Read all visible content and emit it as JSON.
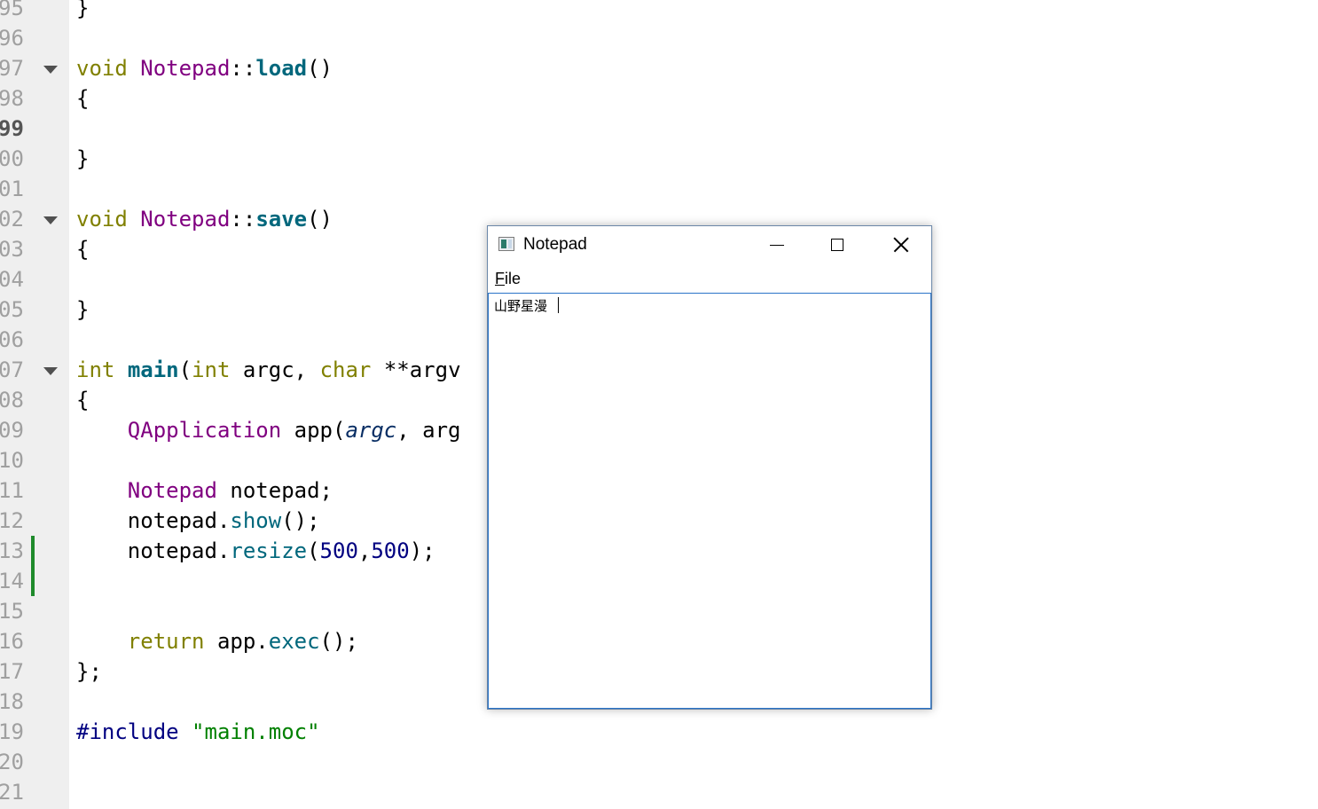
{
  "editor": {
    "lines": [
      {
        "num": "95",
        "segments": [
          {
            "t": "}",
            "c": ""
          }
        ]
      },
      {
        "num": "96",
        "segments": []
      },
      {
        "num": "97",
        "fold": true,
        "segments": [
          {
            "t": "void",
            "c": "kw"
          },
          {
            "t": " ",
            "c": ""
          },
          {
            "t": "Notepad",
            "c": "ty"
          },
          {
            "t": "::",
            "c": ""
          },
          {
            "t": "load",
            "c": "fn"
          },
          {
            "t": "()",
            "c": ""
          }
        ]
      },
      {
        "num": "98",
        "segments": [
          {
            "t": "{",
            "c": ""
          }
        ]
      },
      {
        "num": "99",
        "current": true,
        "segments": []
      },
      {
        "num": "00",
        "segments": [
          {
            "t": "}",
            "c": ""
          }
        ]
      },
      {
        "num": "01",
        "segments": []
      },
      {
        "num": "02",
        "fold": true,
        "segments": [
          {
            "t": "void",
            "c": "kw"
          },
          {
            "t": " ",
            "c": ""
          },
          {
            "t": "Notepad",
            "c": "ty"
          },
          {
            "t": "::",
            "c": ""
          },
          {
            "t": "save",
            "c": "fn"
          },
          {
            "t": "()",
            "c": ""
          }
        ]
      },
      {
        "num": "03",
        "segments": [
          {
            "t": "{",
            "c": ""
          }
        ]
      },
      {
        "num": "04",
        "segments": []
      },
      {
        "num": "05",
        "segments": [
          {
            "t": "}",
            "c": ""
          }
        ]
      },
      {
        "num": "06",
        "segments": []
      },
      {
        "num": "07",
        "fold": true,
        "segments": [
          {
            "t": "int",
            "c": "kw"
          },
          {
            "t": " ",
            "c": ""
          },
          {
            "t": "main",
            "c": "fn"
          },
          {
            "t": "(",
            "c": ""
          },
          {
            "t": "int",
            "c": "kw"
          },
          {
            "t": " argc, ",
            "c": ""
          },
          {
            "t": "char",
            "c": "kw"
          },
          {
            "t": " **argv",
            "c": ""
          }
        ]
      },
      {
        "num": "08",
        "segments": [
          {
            "t": "{",
            "c": ""
          }
        ]
      },
      {
        "num": "09",
        "segments": [
          {
            "t": "    ",
            "c": ""
          },
          {
            "t": "QApplication",
            "c": "ty"
          },
          {
            "t": " app(",
            "c": ""
          },
          {
            "t": "argc",
            "c": "pa"
          },
          {
            "t": ", arg",
            "c": ""
          }
        ]
      },
      {
        "num": "10",
        "segments": []
      },
      {
        "num": "11",
        "segments": [
          {
            "t": "    ",
            "c": ""
          },
          {
            "t": "Notepad",
            "c": "ty"
          },
          {
            "t": " notepad;",
            "c": ""
          }
        ]
      },
      {
        "num": "12",
        "segments": [
          {
            "t": "    notepad.",
            "c": ""
          },
          {
            "t": "show",
            "c": "me"
          },
          {
            "t": "();",
            "c": ""
          }
        ]
      },
      {
        "num": "13",
        "changed": true,
        "segments": [
          {
            "t": "    notepad.",
            "c": ""
          },
          {
            "t": "resize",
            "c": "me"
          },
          {
            "t": "(",
            "c": ""
          },
          {
            "t": "500",
            "c": "nu"
          },
          {
            "t": ",",
            "c": ""
          },
          {
            "t": "500",
            "c": "nu"
          },
          {
            "t": ");",
            "c": ""
          }
        ]
      },
      {
        "num": "14",
        "changed": true,
        "segments": []
      },
      {
        "num": "15",
        "segments": []
      },
      {
        "num": "16",
        "segments": [
          {
            "t": "    ",
            "c": ""
          },
          {
            "t": "return",
            "c": "kw"
          },
          {
            "t": " app.",
            "c": ""
          },
          {
            "t": "exec",
            "c": "me"
          },
          {
            "t": "();",
            "c": ""
          }
        ]
      },
      {
        "num": "17",
        "segments": [
          {
            "t": "};",
            "c": ""
          }
        ]
      },
      {
        "num": "18",
        "segments": []
      },
      {
        "num": "19",
        "segments": [
          {
            "t": "#include",
            "c": "pp"
          },
          {
            "t": " ",
            "c": ""
          },
          {
            "t": "\"main.moc\"",
            "c": "st"
          }
        ]
      },
      {
        "num": "20",
        "segments": []
      },
      {
        "num": "21",
        "segments": []
      }
    ]
  },
  "notepad_window": {
    "title": "Notepad",
    "icon": "app-window-icon",
    "controls": [
      "minimize-icon",
      "maximize-icon",
      "close-icon"
    ],
    "menu": [
      "File"
    ],
    "content": "山野星漫"
  }
}
